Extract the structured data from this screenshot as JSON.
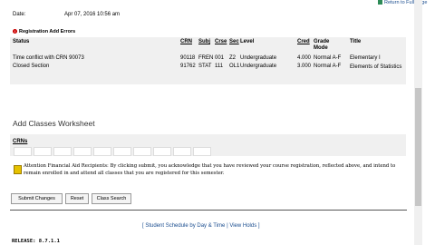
{
  "header": {
    "return_link": "Return to Full Page"
  },
  "date": {
    "label": "Date:",
    "value": "Apr 07, 2016 10:56 am"
  },
  "errors": {
    "title": "Registration Add Errors",
    "columns": [
      "Status",
      "CRN",
      "Subj",
      "Crse",
      "Sec",
      "Level",
      "Cred",
      "Grade Mode",
      "Title"
    ],
    "rows": [
      {
        "status": "Time conflict with CRN 90073",
        "crn": "90118",
        "subj": "FREN",
        "crse": "001",
        "sec": "Z2",
        "level": "Undergraduate",
        "cred": "4.000",
        "grade_mode": "Normal A-F",
        "title": "Elementary I"
      },
      {
        "status": "Closed Section",
        "crn": "91762",
        "subj": "STAT",
        "crse": "111",
        "sec": "OL1",
        "level": "Undergraduate",
        "cred": "3.000",
        "grade_mode": "Normal A-F",
        "title": "Elements of Statistics"
      }
    ]
  },
  "worksheet": {
    "title": "Add Classes Worksheet",
    "crn_label": "CRNs"
  },
  "notice": {
    "text": "Attention Financial Aid Recipients: By clicking submit, you acknowledge that you have reviewed your course registration, reflected above, and intend to remain enrolled in and attend all classes that you are registered for this semester."
  },
  "buttons": {
    "submit": "Submit Changes",
    "reset": "Reset",
    "search": "Class Search"
  },
  "footer": {
    "open": "[",
    "schedule": "Student Schedule by Day & Time",
    "sep": "|",
    "holds": "View Holds",
    "close": "]"
  },
  "release": "RELEASE: 8.7.1.1"
}
